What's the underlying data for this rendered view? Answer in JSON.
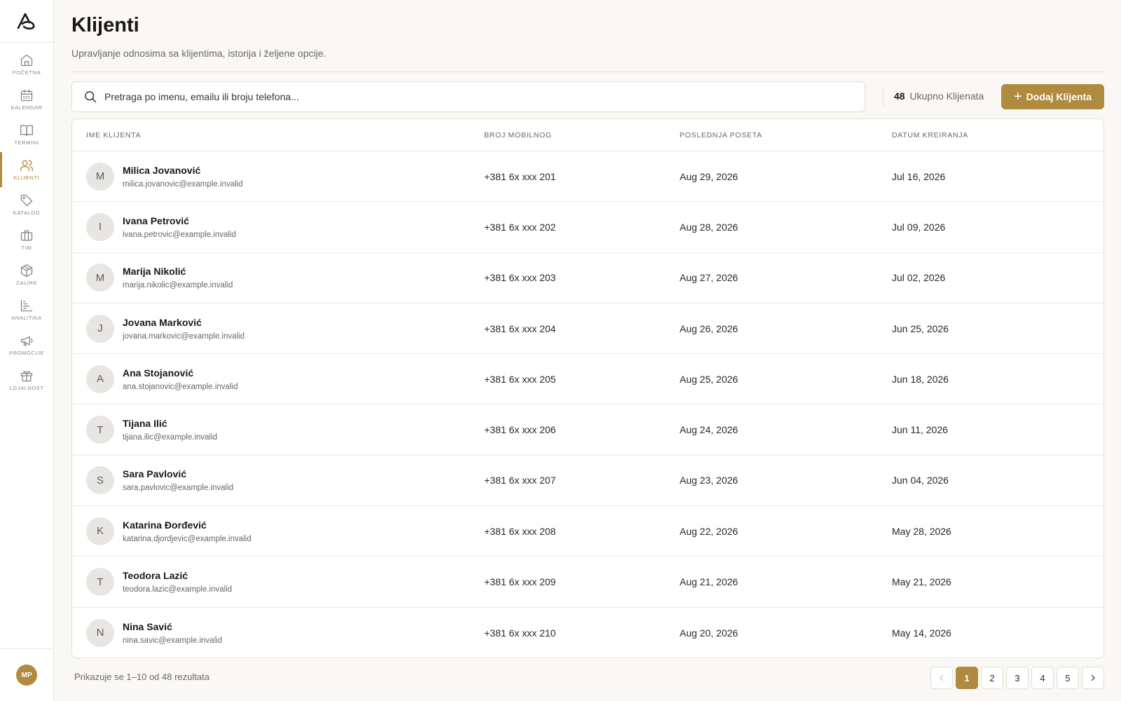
{
  "colors": {
    "accent": "#b08a3e",
    "background": "#faf8f4"
  },
  "sidebar": {
    "logo": "brand-logo-icon",
    "items": [
      {
        "label": "POČETNA",
        "icon": "home-icon",
        "active": false
      },
      {
        "label": "KALENDAR",
        "icon": "calendar-icon",
        "active": false
      },
      {
        "label": "TERMINI",
        "icon": "book-icon",
        "active": false
      },
      {
        "label": "KLIJENTI",
        "icon": "users-icon",
        "active": true
      },
      {
        "label": "KATALOG",
        "icon": "tag-icon",
        "active": false
      },
      {
        "label": "TIM",
        "icon": "briefcase-icon",
        "active": false
      },
      {
        "label": "ZALIHE",
        "icon": "box-icon",
        "active": false
      },
      {
        "label": "ANALITIKA",
        "icon": "bar-chart-icon",
        "active": false
      },
      {
        "label": "PROMOCIJE",
        "icon": "megaphone-icon",
        "active": false
      },
      {
        "label": "LOJALNOST",
        "icon": "gift-icon",
        "active": false
      }
    ],
    "user_initials": "MP"
  },
  "header": {
    "title": "Klijenti",
    "subtitle": "Upravljanje odnosima sa klijentima, istorija i željene opcije."
  },
  "toolbar": {
    "search_placeholder": "Pretraga po imenu, emailu ili broju telefona...",
    "total_count": "48",
    "total_label": "Ukupno Klijenata",
    "add_button": "Dodaj Klijenta"
  },
  "table": {
    "columns": [
      "IME KLIJENTA",
      "BROJ MOBILNOG",
      "POSLEDNJA POSETA",
      "DATUM KREIRANJA"
    ],
    "rows": [
      {
        "initial": "M",
        "name": "Milica Jovanović",
        "email": "milica.jovanovic@example.invalid",
        "phone": "+381 6x xxx 201",
        "last_visit": "Aug 29, 2026",
        "created": "Jul 16, 2026"
      },
      {
        "initial": "I",
        "name": "Ivana Petrović",
        "email": "ivana.petrovic@example.invalid",
        "phone": "+381 6x xxx 202",
        "last_visit": "Aug 28, 2026",
        "created": "Jul 09, 2026"
      },
      {
        "initial": "M",
        "name": "Marija Nikolić",
        "email": "marija.nikolic@example.invalid",
        "phone": "+381 6x xxx 203",
        "last_visit": "Aug 27, 2026",
        "created": "Jul 02, 2026"
      },
      {
        "initial": "J",
        "name": "Jovana Marković",
        "email": "jovana.markovic@example.invalid",
        "phone": "+381 6x xxx 204",
        "last_visit": "Aug 26, 2026",
        "created": "Jun 25, 2026"
      },
      {
        "initial": "A",
        "name": "Ana Stojanović",
        "email": "ana.stojanovic@example.invalid",
        "phone": "+381 6x xxx 205",
        "last_visit": "Aug 25, 2026",
        "created": "Jun 18, 2026"
      },
      {
        "initial": "T",
        "name": "Tijana Ilić",
        "email": "tijana.ilic@example.invalid",
        "phone": "+381 6x xxx 206",
        "last_visit": "Aug 24, 2026",
        "created": "Jun 11, 2026"
      },
      {
        "initial": "S",
        "name": "Sara Pavlović",
        "email": "sara.pavlovic@example.invalid",
        "phone": "+381 6x xxx 207",
        "last_visit": "Aug 23, 2026",
        "created": "Jun 04, 2026"
      },
      {
        "initial": "K",
        "name": "Katarina Đorđević",
        "email": "katarina.djordjevic@example.invalid",
        "phone": "+381 6x xxx 208",
        "last_visit": "Aug 22, 2026",
        "created": "May 28, 2026"
      },
      {
        "initial": "T",
        "name": "Teodora Lazić",
        "email": "teodora.lazic@example.invalid",
        "phone": "+381 6x xxx 209",
        "last_visit": "Aug 21, 2026",
        "created": "May 21, 2026"
      },
      {
        "initial": "N",
        "name": "Nina Savić",
        "email": "nina.savic@example.invalid",
        "phone": "+381 6x xxx 210",
        "last_visit": "Aug 20, 2026",
        "created": "May 14, 2026"
      }
    ]
  },
  "footer": {
    "results_text": "Prikazuje se 1–10 od 48 rezultata",
    "pages": [
      "1",
      "2",
      "3",
      "4",
      "5"
    ],
    "current_page": "1",
    "prev_icon": "chevron-left-icon",
    "next_icon": "chevron-right-icon"
  }
}
